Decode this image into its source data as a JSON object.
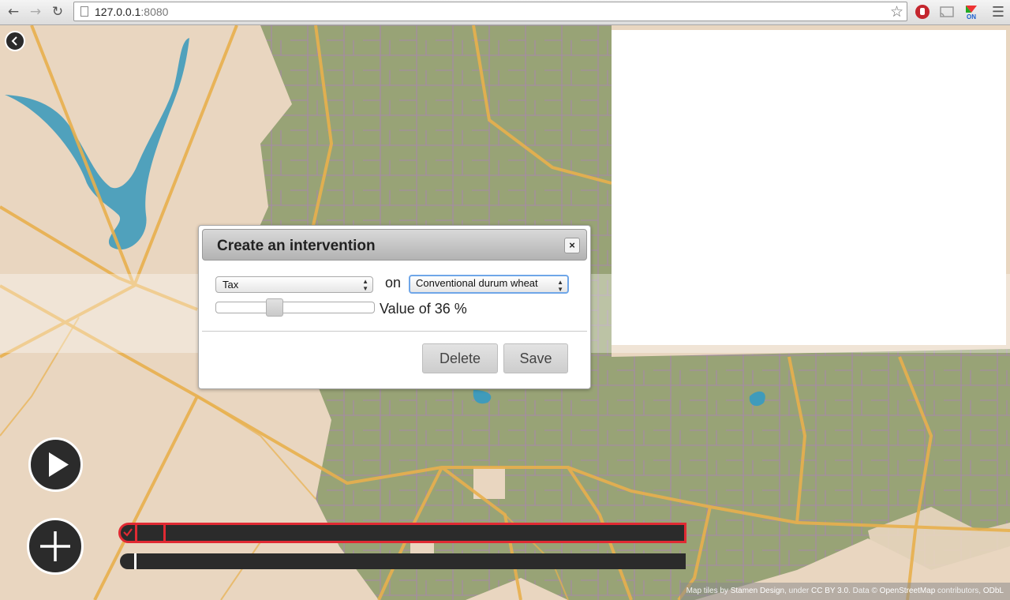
{
  "browser": {
    "url_host": "127.0.0.1",
    "url_port": ":8080"
  },
  "dialog": {
    "title": "Create an intervention",
    "close_label": "×",
    "type_select": {
      "value": "Tax"
    },
    "on_label": "on",
    "target_select": {
      "value": "Conventional durum wheat"
    },
    "slider": {
      "value_percent": 36,
      "min": 0,
      "max": 100
    },
    "value_text": "Value of 36 %",
    "delete_label": "Delete",
    "save_label": "Save"
  },
  "attribution": {
    "prefix": "Map tiles by ",
    "stamen": "Stamen Design",
    "mid": ", under ",
    "license": "CC BY 3.0",
    "data": ". Data © ",
    "osm": "OpenStreetMap",
    "suffix": " contributors, ",
    "odbl": "ODbL"
  },
  "colors": {
    "timeline_bg": "#2b2b2b",
    "timeline_active_border": "#e02a33",
    "parcel_fill": "#7f9560",
    "parcel_stroke": "#9b7aa6",
    "water": "#3f9bbb",
    "road": "#e8b04d"
  },
  "timeline": {
    "active_progress": 0.05
  }
}
